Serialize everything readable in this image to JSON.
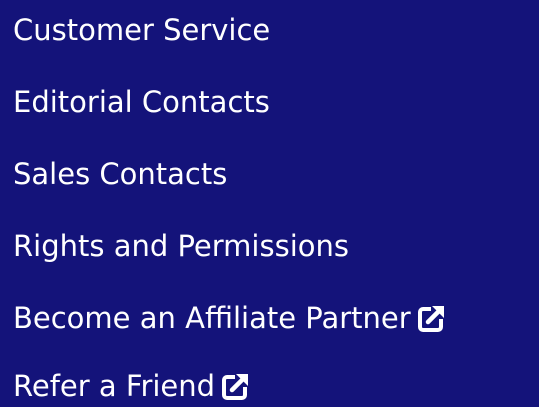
{
  "colors": {
    "background": "#14137a",
    "text": "#ffffff"
  },
  "menu": {
    "items": [
      {
        "label": "Customer Service",
        "external": false
      },
      {
        "label": "Editorial Contacts",
        "external": false
      },
      {
        "label": "Sales Contacts",
        "external": false
      },
      {
        "label": "Rights and Permissions",
        "external": false
      },
      {
        "label": "Become an Affiliate Partner",
        "external": true,
        "icon": "external-link-icon"
      },
      {
        "label": "Refer a Friend",
        "external": true,
        "icon": "external-link-icon"
      }
    ]
  }
}
